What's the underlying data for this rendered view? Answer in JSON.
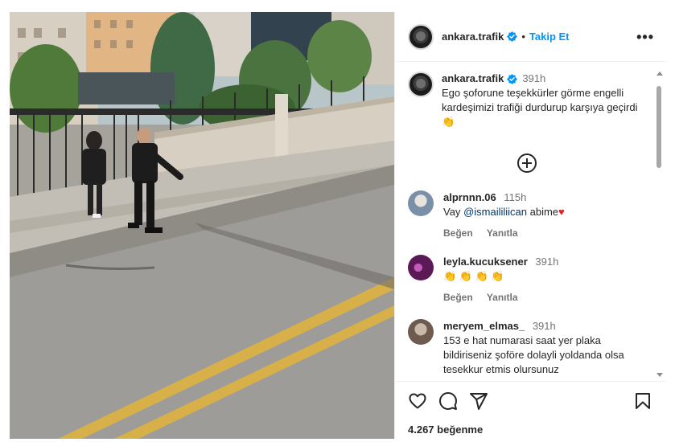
{
  "post": {
    "account": "ankara.trafik",
    "follow_label": "Takip Et",
    "more_label": "•••",
    "separator": "•"
  },
  "caption": {
    "username": "ankara.trafik",
    "time": "391h",
    "text": "Ego şoforune teşekkürler görme engelli kardeşimizi trafiği durdurup karşıya geçirdi 👏"
  },
  "comments": [
    {
      "username": "alprnnn.06",
      "time": "115h",
      "text_before": "Vay ",
      "mention": "@ismaililiican",
      "text_after": " abime",
      "emoji": "♥",
      "like_label": "Beğen",
      "reply_label": "Yanıtla",
      "avatar_color": "#7a8fa8"
    },
    {
      "username": "leyla.kucuksener",
      "time": "391h",
      "text": "👏 👏 👏 👏",
      "like_label": "Beğen",
      "reply_label": "Yanıtla",
      "avatar_color": "#5b1a55"
    },
    {
      "username": "meryem_elmas_",
      "time": "391h",
      "text": "153 e hat numarasi saat yer plaka bildiriseniz şoföre dolayli yoldanda olsa tesekkur etmis olursunuz",
      "avatar_color": "#6e5a4e"
    }
  ],
  "footer": {
    "likes": "4.267 beğenme"
  },
  "colors": {
    "link": "#0095f6",
    "mention": "#00376b",
    "verified": "#0095f6"
  }
}
